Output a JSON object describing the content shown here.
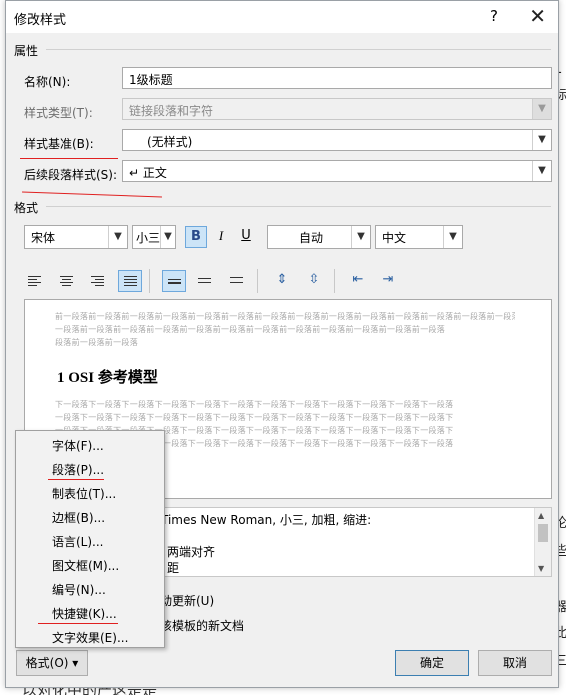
{
  "dialog": {
    "title": "修改样式",
    "help": "?",
    "close": "✕"
  },
  "sections": {
    "properties": "属性",
    "format": "格式"
  },
  "properties": {
    "name": {
      "label": "名称(N):",
      "value": "1级标题"
    },
    "style_type": {
      "label": "样式类型(T):",
      "value": "链接段落和字符"
    },
    "based_on": {
      "label": "样式基准(B):",
      "value": "(无样式)"
    },
    "next_style": {
      "label": "后续段落样式(S):",
      "value": "↵ 正文"
    }
  },
  "format_toolbar": {
    "font": "宋体",
    "size": "小三",
    "bold": "B",
    "italic": "I",
    "underline": "U",
    "color": "自动",
    "script": "中文"
  },
  "preview": {
    "prev_lines": [
      "前一段落前一段落前一段落前一段落前一段落前一段落前一段落前一段落前一段落前一段落前一段落前一段落前一段落前一段落前一段落前一段落前一段落前一段落前一段落前一段落前一段落前一段落前一段落前一段落前一段落前一段落前一段落前一段落前一段落前一段落前一段落前一段落前一段落前一段落前一段落前一段落前一段落前一段落前一段落前一段落前一段落前一段落前一段落前一段落前一段落前一段落前一段落前一段落前一段落前一段落前一段落前一段落前一段落前一段落前一段落前一段落前一段落前一段落前一段落前一段落前一段落前一段落前一段落前一段落前一段落前一段落前一段落",
      "一段落前一段落前一段落前一段落前一段落前一段落前一段落前一段落前一段落前一段落前一段落前一段落",
      "段落前一段落前一段落"
    ],
    "heading": "1   OSI 参考模型",
    "next_lines": [
      "下一段落下一段落下一段落下一段落下一段落下一段落下一段落下一段落下一段落下一段落下一段落下一段落",
      "一段落下一段落下一段落下一段落下一段落下一段落下一段落下一段落下一段落下一段落下一段落下一段落下",
      "一段落下一段落下一段落下一段落下一段落下一段落下一段落下一段落下一段落下一段落下一段落下一段落下",
      "下一段落下一段落下一段落下一段落下一段落下一段落下一段落下一段落下一段落下一段落下一段落下一段落"
    ]
  },
  "description": {
    "line1": "Times New Roman, 小三, 加粗, 缩进:",
    "line2": "两端对齐",
    "line3": "距"
  },
  "options": {
    "auto_update": "动更新(U)",
    "template": "该模板的新文档"
  },
  "buttons": {
    "format": "格式(O) ▾",
    "ok": "确定",
    "cancel": "取消"
  },
  "format_menu": {
    "items": [
      "字体(F)...",
      "段落(P)...",
      "制表位(T)...",
      "边框(B)...",
      "语言(L)...",
      "图文框(M)...",
      "编号(N)...",
      "快捷键(K)...",
      "文字效果(E)..."
    ]
  },
  "background": {
    "right_chars": [
      "1",
      "标",
      "论",
      "些",
      "器",
      "此",
      "三"
    ],
    "bottom_text": "以对化中的产这是是"
  }
}
